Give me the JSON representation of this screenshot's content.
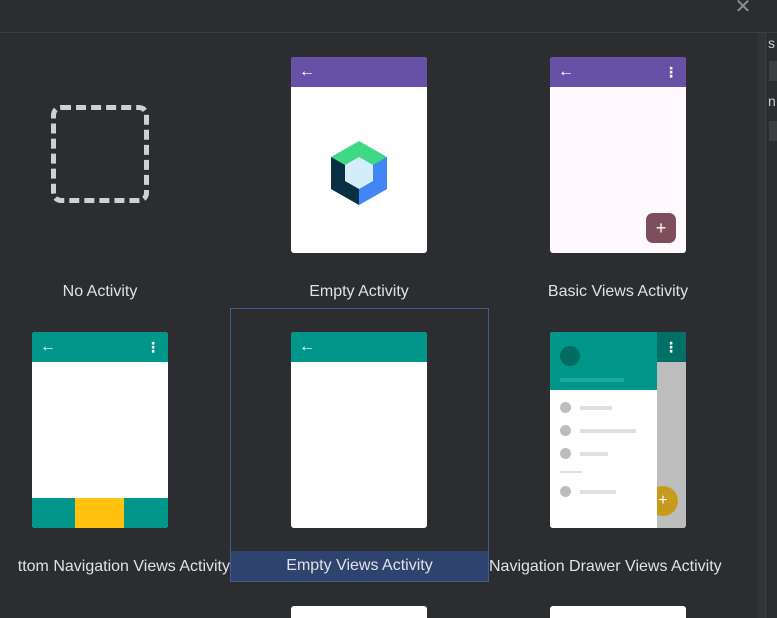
{
  "dialog": {
    "close_icon": "close-icon"
  },
  "templates": [
    {
      "label": "No Activity"
    },
    {
      "label": "Empty Activity"
    },
    {
      "label": "Basic Views Activity"
    },
    {
      "label": "ttom Navigation Views Activity"
    },
    {
      "label": "Empty Views Activity"
    },
    {
      "label": "Navigation Drawer Views Activity"
    }
  ],
  "selected_template": "Empty Views Activity",
  "right_panel": {
    "letter_top": "s",
    "letter_mid": "n"
  },
  "colors": {
    "background": "#2b2d30",
    "purple_appbar": "#6751a7",
    "teal_appbar": "#00968a",
    "selection": "#2e436e",
    "fab": "#7d4f5d",
    "bottom_nav_selected": "#ffc210"
  },
  "icons": {
    "back": "←",
    "more": "⋮",
    "plus": "+",
    "close": "✕"
  }
}
